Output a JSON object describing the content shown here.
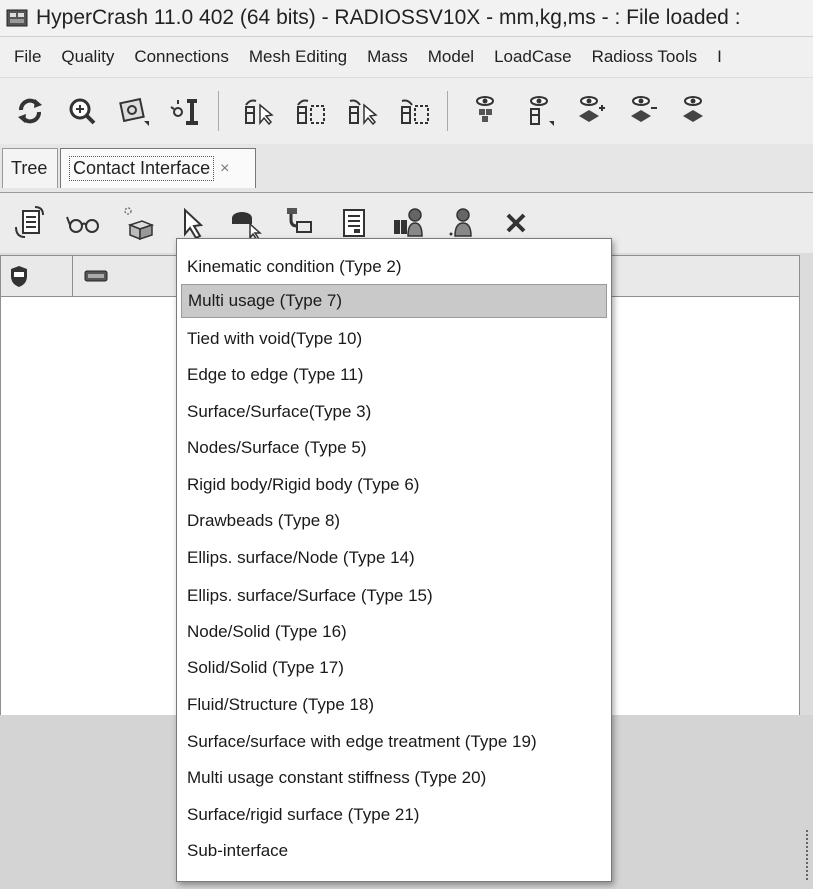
{
  "window": {
    "title": "HyperCrash 11.0 402 (64 bits) - RADIOSSV10X - mm,kg,ms - : File loaded :"
  },
  "menubar": {
    "items": [
      "File",
      "Quality",
      "Connections",
      "Mesh Editing",
      "Mass",
      "Model",
      "LoadCase",
      "Radioss Tools",
      "I"
    ]
  },
  "tabs": [
    {
      "label": "Tree"
    },
    {
      "label": "Contact Interface",
      "close": "×"
    }
  ],
  "contact_menu": {
    "selected_index": 1,
    "items": [
      "Kinematic condition (Type  2)",
      "Multi usage (Type  7)",
      "Tied with void(Type 10)",
      "Edge to edge (Type 11)",
      "Surface/Surface(Type  3)",
      "Nodes/Surface (Type  5)",
      "Rigid body/Rigid body (Type  6)",
      "Drawbeads (Type  8)",
      "Ellips. surface/Node (Type 14)",
      "Ellips. surface/Surface (Type 15)",
      "Node/Solid (Type 16)",
      "Solid/Solid (Type 17)",
      "Fluid/Structure (Type 18)",
      "Surface/surface with edge treatment (Type 19)",
      "Multi usage constant stiffness (Type 20)",
      "Surface/rigid surface (Type 21)",
      "Sub-interface"
    ]
  }
}
